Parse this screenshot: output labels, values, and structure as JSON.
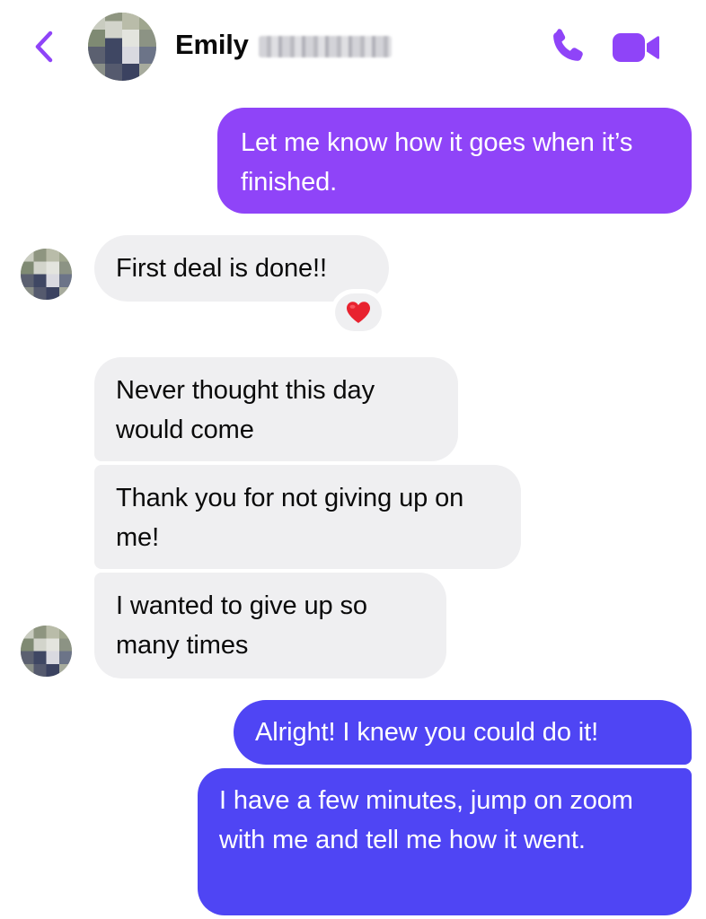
{
  "header": {
    "contact_first_name": "Emily",
    "back_icon": "chevron-left-icon",
    "call_icon": "phone-icon",
    "video_icon": "video-camera-icon",
    "accent_color": "#8f44f8"
  },
  "messages": [
    {
      "direction": "outgoing",
      "text": "Let me know how it goes when it’s finished."
    },
    {
      "direction": "incoming",
      "text": "First deal is done!!",
      "reaction": "red-heart-icon"
    },
    {
      "direction": "incoming",
      "text": "Never thought this day would come"
    },
    {
      "direction": "incoming",
      "text": "Thank you for not giving up on me!"
    },
    {
      "direction": "incoming",
      "text": "I wanted to give up so many times"
    },
    {
      "direction": "outgoing",
      "text": "Alright! I knew you could do it!"
    },
    {
      "direction": "outgoing",
      "text": "I have a few minutes, jump on zoom with me and tell me how it went."
    }
  ],
  "colors": {
    "outgoing_top": "#8f44f8",
    "outgoing_bottom": "#4f45f4",
    "incoming_bubble": "#efeff1",
    "heart": "#e8222f"
  }
}
